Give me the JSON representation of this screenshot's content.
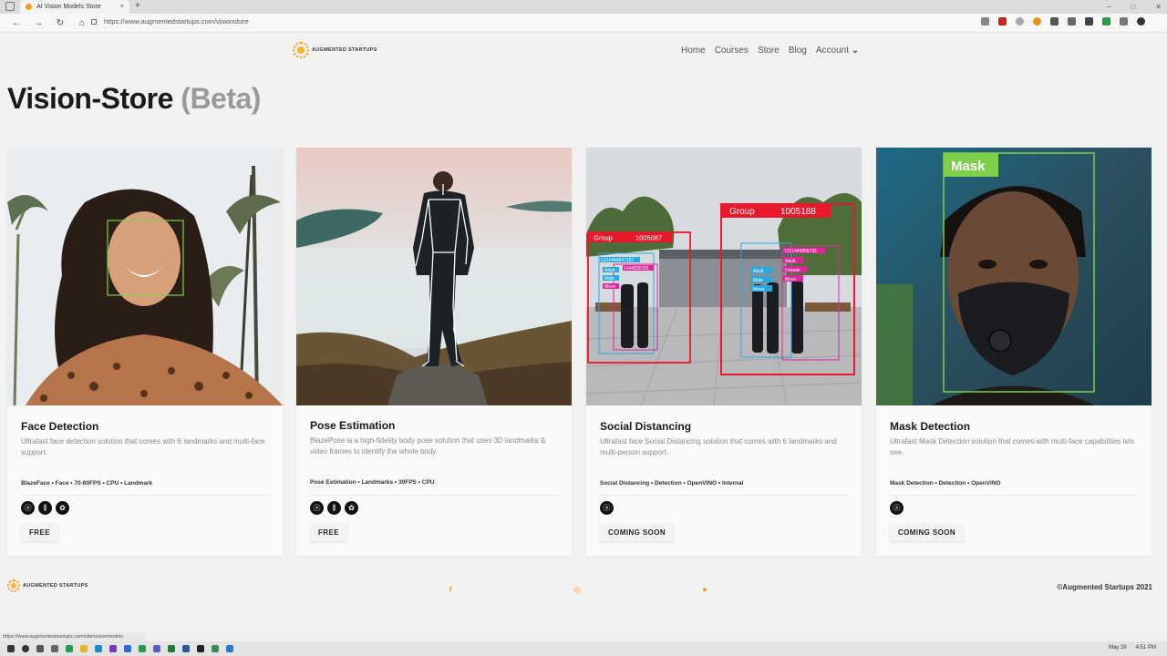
{
  "browser": {
    "tab_title": "AI Vision Models Store",
    "tab_close": "×",
    "new_tab": "+",
    "url": "https://www.augmentedstartups.com/visionstore",
    "status_url": "https://www.augmentedstartups.com/site/visionmodels",
    "nav": {
      "back": "←",
      "forward": "→",
      "reload": "↻",
      "home": "⌂"
    },
    "window_controls": {
      "minimize": "–",
      "maximize": "□",
      "close": "✕"
    }
  },
  "site": {
    "logo_text": "AUGMENTED STARTUPS",
    "menu": [
      "Home",
      "Courses",
      "Store",
      "Blog"
    ],
    "account_label": "Account",
    "account_chevron": "⌄",
    "heading_main": "Vision-Store",
    "heading_beta": "(Beta)"
  },
  "cards": [
    {
      "title": "Face Detection",
      "description": "Ultrafast face detection solution that comes with 6 landmarks and multi-face support.",
      "tags": "BlazeFace • Face • 70-80FPS • CPU • Landmark",
      "button": "FREE",
      "icons": [
        "augmented-startups-icon",
        "equalizer-icon",
        "gear-icon"
      ]
    },
    {
      "title": "Pose Estimation",
      "description": "BlazePose is a high-fidelity body pose solution that uses 3D landmarks & video frames to identify the whole body.",
      "tags": "Pose Estimation • Landmarks • 30FPS • CPU",
      "button": "FREE",
      "icons": [
        "augmented-startups-icon",
        "equalizer-icon",
        "gear-icon"
      ]
    },
    {
      "title": "Social Distancing",
      "description": "Ultrafast face Social Distancing solution that comes with 6 landmarks and multi-person support.",
      "tags": "Social Distancing • Detection • OpenVINO • Internal",
      "button": "COMING SOON",
      "icons": [
        "augmented-startups-icon"
      ],
      "overlay": {
        "group1_label": "Group",
        "group1_id": "1005087",
        "group2_label": "Group",
        "group2_id": "1005188",
        "id_a": "1221444847157",
        "id_b": "1444830781",
        "id_c": "1221444855791",
        "label_adult": "Adult",
        "label_male": "Male",
        "label_female": "Female",
        "label_move": "Move"
      }
    },
    {
      "title": "Mask Detection",
      "description": "Ultrafast Mask Detection solution that comes with multi-face capabilities lets see.",
      "tags": "Mask Detection  • Detection • OpenVINO",
      "button": "COMING SOON",
      "icons": [
        "augmented-startups-icon"
      ],
      "overlay": {
        "mask_label": "Mask"
      }
    }
  ],
  "footer": {
    "logo_text": "AUGMENTED STARTUPS",
    "facebook": "f",
    "instagram": "◎",
    "youtube": "▶",
    "copyright": "©Augmented Startups 2021"
  },
  "taskbar": {
    "date": "May 28",
    "time": "4:51 PM"
  },
  "colors": {
    "accent": "#f0a020",
    "detection_green": "#7fcf4a",
    "group_red": "#e8192c",
    "tag_blue": "#29a8e0",
    "tag_pink": "#e0249a"
  }
}
